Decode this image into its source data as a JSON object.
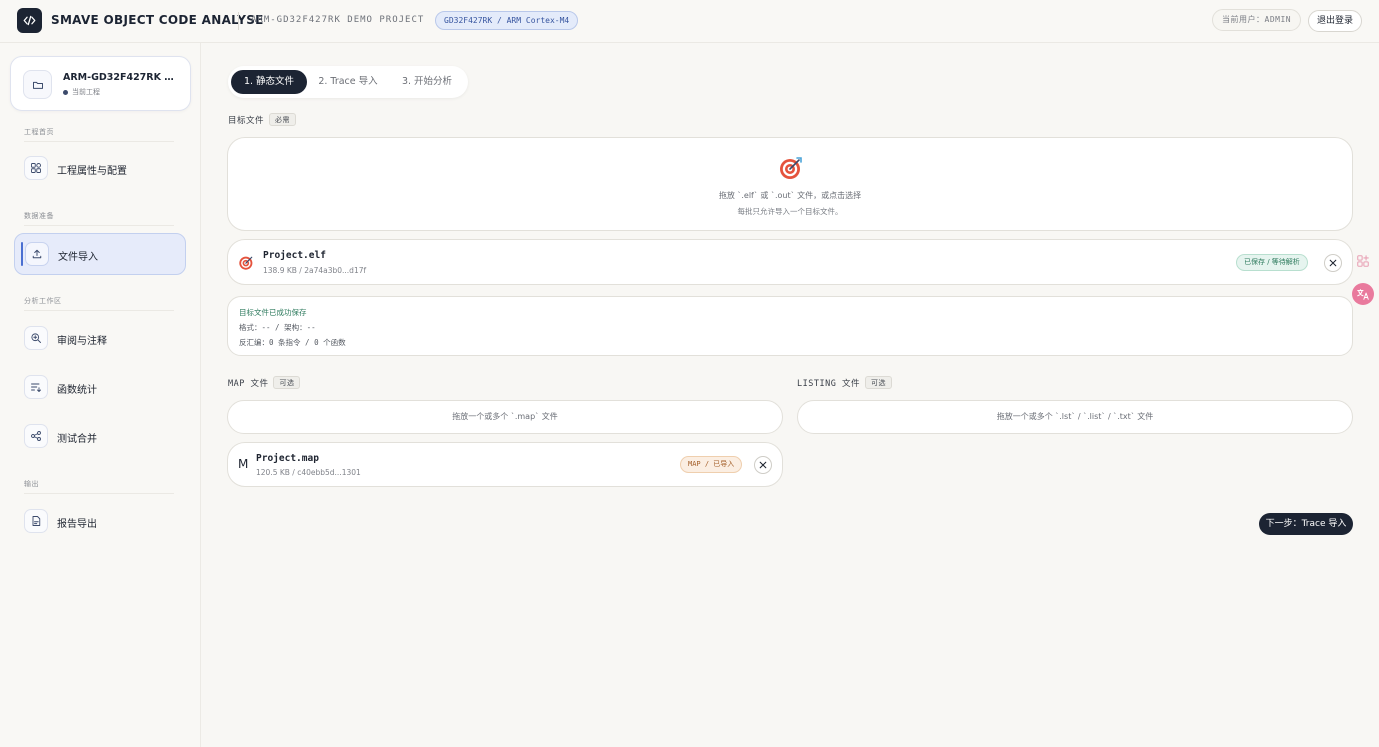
{
  "header": {
    "app_title": "SMAVE OBJECT CODE ANALYSE",
    "project_name": "ARM-GD32F427RK DEMO PROJECT",
    "device_chip": "GD32F427RK / ARM Cortex-M4",
    "current_user": "当前用户：ADMIN",
    "logout_label": "退出登录"
  },
  "sidebar": {
    "project": {
      "name": "ARM-GD32F427RK DEMO PROJECT",
      "status": "当前工程"
    },
    "sections": [
      {
        "label": "工程首页",
        "items": [
          {
            "label": "工程属性与配置",
            "icon": "grid-icon"
          }
        ]
      },
      {
        "label": "数据准备",
        "items": [
          {
            "label": "文件导入",
            "icon": "upload-icon",
            "active": true
          }
        ]
      },
      {
        "label": "分析工作区",
        "items": [
          {
            "label": "审阅与注释",
            "icon": "zoom-icon"
          },
          {
            "label": "函数统计",
            "icon": "list-sort-icon"
          },
          {
            "label": "测试合并",
            "icon": "share-nodes-icon"
          }
        ]
      },
      {
        "label": "输出",
        "items": [
          {
            "label": "报告导出",
            "icon": "document-icon"
          }
        ]
      }
    ]
  },
  "steps": [
    {
      "label": "1. 静态文件",
      "active": true
    },
    {
      "label": "2. Trace 导入"
    },
    {
      "label": "3. 开始分析"
    }
  ],
  "target": {
    "label": "目标文件",
    "tag": "必需",
    "dropzone_line1": "拖放 `.elf` 或 `.out` 文件，或点击选择",
    "dropzone_line2": "每批只允许导入一个目标文件。",
    "file": {
      "name": "Project.elf",
      "meta": "138.9 KB / 2a74a3b0...d17f",
      "status": "已保存 / 等待解析"
    },
    "result": {
      "ok": "目标文件已成功保存",
      "format": "格式：-- / 架构：--",
      "disasm": "反汇编：0 条指令 / 0 个函数"
    }
  },
  "map": {
    "label": "MAP 文件",
    "tag": "可选",
    "dropzone": "拖放一个或多个 `.map` 文件",
    "file": {
      "letter": "M",
      "name": "Project.map",
      "meta": "120.5 KB / c40ebb5d...1301",
      "status": "MAP / 已导入"
    }
  },
  "listing": {
    "label": "LISTING 文件",
    "tag": "可选",
    "dropzone": "拖放一个或多个 `.lst` / `.list` / `.txt` 文件"
  },
  "next_label": "下一步：Trace 导入",
  "colors": {
    "accent": "#1c2433",
    "active_nav": "#e6ebfa",
    "ok_green": "#2d7a5d",
    "map_orange": "#a4602b"
  }
}
